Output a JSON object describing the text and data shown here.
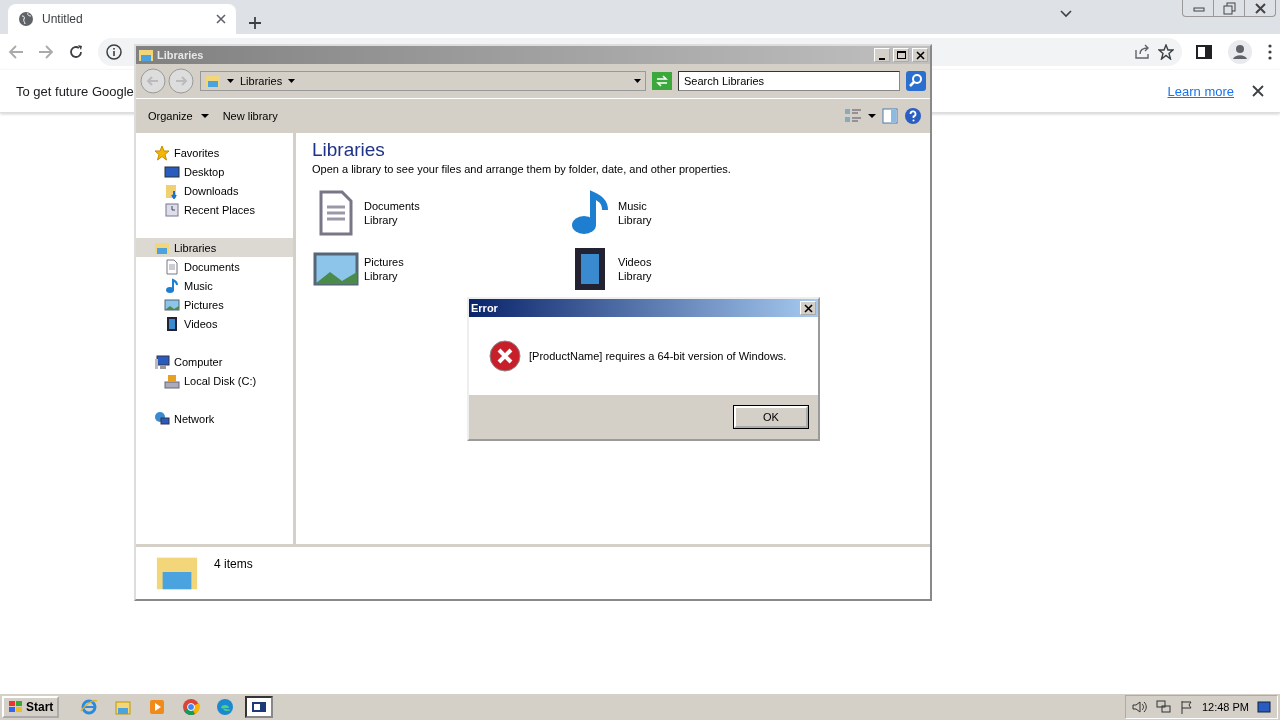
{
  "browser": {
    "tab": {
      "title": "Untitled"
    },
    "infobar": {
      "text": "To get future Google",
      "link": "Learn more"
    }
  },
  "explorer": {
    "title": "Libraries",
    "breadcrumb": "Libraries",
    "search": {
      "placeholder": "Search Libraries"
    },
    "toolbar": [
      {
        "label": "Organize",
        "kind": "menu"
      },
      {
        "label": "New library",
        "kind": "button"
      }
    ],
    "nav": [
      {
        "label": "Favorites",
        "kind": "star",
        "selected": false,
        "children": [
          {
            "label": "Desktop",
            "kind": "desktop",
            "selected": false
          },
          {
            "label": "Downloads",
            "kind": "downloads",
            "selected": false
          },
          {
            "label": "Recent Places",
            "kind": "recent",
            "selected": false
          }
        ]
      },
      {
        "label": "Libraries",
        "kind": "libraries",
        "selected": true,
        "children": [
          {
            "label": "Documents",
            "kind": "documents",
            "selected": false
          },
          {
            "label": "Music",
            "kind": "music",
            "selected": false
          },
          {
            "label": "Pictures",
            "kind": "pictures",
            "selected": false
          },
          {
            "label": "Videos",
            "kind": "videos",
            "selected": false
          }
        ]
      },
      {
        "label": "Computer",
        "kind": "computer",
        "selected": false,
        "children": [
          {
            "label": "Local Disk (C:)",
            "kind": "disk",
            "selected": false
          }
        ]
      },
      {
        "label": "Network",
        "kind": "network",
        "selected": false
      }
    ],
    "heading": "Libraries",
    "description": "Open a library to see your files and arrange them by folder, date, and other properties.",
    "libraries": [
      {
        "name": "Documents",
        "subtitle": "Library",
        "kind": "documents"
      },
      {
        "name": "Music",
        "subtitle": "Library",
        "kind": "music"
      },
      {
        "name": "Pictures",
        "subtitle": "Library",
        "kind": "pictures"
      },
      {
        "name": "Videos",
        "subtitle": "Library",
        "kind": "videos"
      }
    ],
    "status": "4 items"
  },
  "dialog": {
    "title": "Error",
    "message": "[ProductName] requires a 64-bit version of Windows.",
    "button": "OK"
  },
  "taskbar": {
    "start": "Start",
    "apps": [
      {
        "kind": "ie",
        "selected": false
      },
      {
        "kind": "explorer",
        "selected": false
      },
      {
        "kind": "media",
        "selected": false
      },
      {
        "kind": "chrome",
        "selected": false
      },
      {
        "kind": "edge",
        "selected": false
      },
      {
        "kind": "window",
        "selected": true
      }
    ],
    "clock": "12:48 PM"
  }
}
